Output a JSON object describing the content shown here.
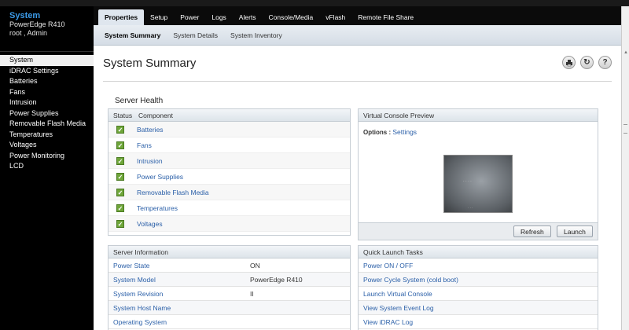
{
  "sidebar": {
    "title": "System",
    "model": "PowerEdge R410",
    "user": "root , Admin",
    "items": [
      {
        "label": "System"
      },
      {
        "label": "iDRAC Settings"
      },
      {
        "label": "Batteries"
      },
      {
        "label": "Fans"
      },
      {
        "label": "Intrusion"
      },
      {
        "label": "Power Supplies"
      },
      {
        "label": "Removable Flash Media"
      },
      {
        "label": "Temperatures"
      },
      {
        "label": "Voltages"
      },
      {
        "label": "Power Monitoring"
      },
      {
        "label": "LCD"
      }
    ]
  },
  "tabs": [
    {
      "label": "Properties"
    },
    {
      "label": "Setup"
    },
    {
      "label": "Power"
    },
    {
      "label": "Logs"
    },
    {
      "label": "Alerts"
    },
    {
      "label": "Console/Media"
    },
    {
      "label": "vFlash"
    },
    {
      "label": "Remote File Share"
    }
  ],
  "subtabs": [
    {
      "label": "System Summary"
    },
    {
      "label": "System Details"
    },
    {
      "label": "System Inventory"
    }
  ],
  "page": {
    "title": "System Summary",
    "icons": [
      "print-icon",
      "refresh-icon",
      "help-icon"
    ]
  },
  "health": {
    "section_title": "Server Health",
    "col_status": "Status",
    "col_component": "Component",
    "rows": [
      {
        "component": "Batteries",
        "status": "ok"
      },
      {
        "component": "Fans",
        "status": "ok"
      },
      {
        "component": "Intrusion",
        "status": "ok"
      },
      {
        "component": "Power Supplies",
        "status": "ok"
      },
      {
        "component": "Removable Flash Media",
        "status": "ok"
      },
      {
        "component": "Temperatures",
        "status": "ok"
      },
      {
        "component": "Voltages",
        "status": "ok"
      }
    ]
  },
  "console": {
    "title": "Virtual Console Preview",
    "options_label": "Options :",
    "settings_link": "Settings",
    "refresh_button": "Refresh",
    "launch_button": "Launch"
  },
  "server_info": {
    "title": "Server Information",
    "rows": [
      {
        "label": "Power State",
        "value": "ON"
      },
      {
        "label": "System Model",
        "value": "PowerEdge R410"
      },
      {
        "label": "System Revision",
        "value": "II"
      },
      {
        "label": "System Host Name",
        "value": ""
      },
      {
        "label": "Operating System",
        "value": ""
      }
    ]
  },
  "quick_launch": {
    "title": "Quick Launch Tasks",
    "items": [
      {
        "label": "Power ON / OFF"
      },
      {
        "label": "Power Cycle System (cold boot)"
      },
      {
        "label": "Launch Virtual Console"
      },
      {
        "label": "View System Event Log"
      },
      {
        "label": "View iDRAC Log"
      }
    ]
  },
  "colors": {
    "accent": "#3b9ae8",
    "link": "#2a5fa8",
    "ok": "#6fa63a"
  }
}
